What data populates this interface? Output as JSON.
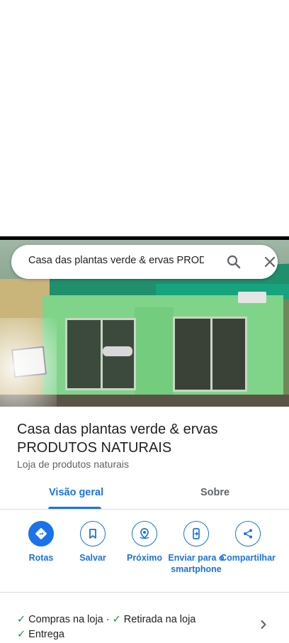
{
  "search": {
    "query": "Casa das plantas verde & ervas PRODUTOS NATURAIS"
  },
  "place": {
    "name": "Casa das plantas verde & ervas PRODUTOS NATURAIS",
    "category": "Loja de produtos naturais"
  },
  "tabs": [
    {
      "label": "Visão geral",
      "active": true
    },
    {
      "label": "Sobre",
      "active": false
    }
  ],
  "actions": [
    {
      "label": "Rotas",
      "icon": "directions-icon"
    },
    {
      "label": "Salvar",
      "icon": "bookmark-icon"
    },
    {
      "label": "Próximo",
      "icon": "nearby-icon"
    },
    {
      "label": "Enviar para o smartphone",
      "icon": "send-to-phone-icon"
    },
    {
      "label": "Compartilhar",
      "icon": "share-icon"
    }
  ],
  "services": {
    "items": [
      "Compras na loja",
      "Retirada na loja",
      "Entrega"
    ],
    "separator": "·"
  },
  "colors": {
    "accent": "#1a73e8",
    "check": "#1e8e3e",
    "text": "#202124",
    "secondary_text": "#5f6368"
  }
}
